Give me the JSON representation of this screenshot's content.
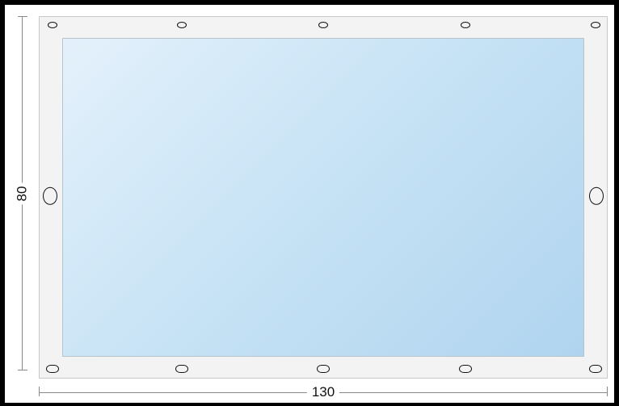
{
  "dimensions": {
    "height_label": "80",
    "width_label": "130"
  }
}
